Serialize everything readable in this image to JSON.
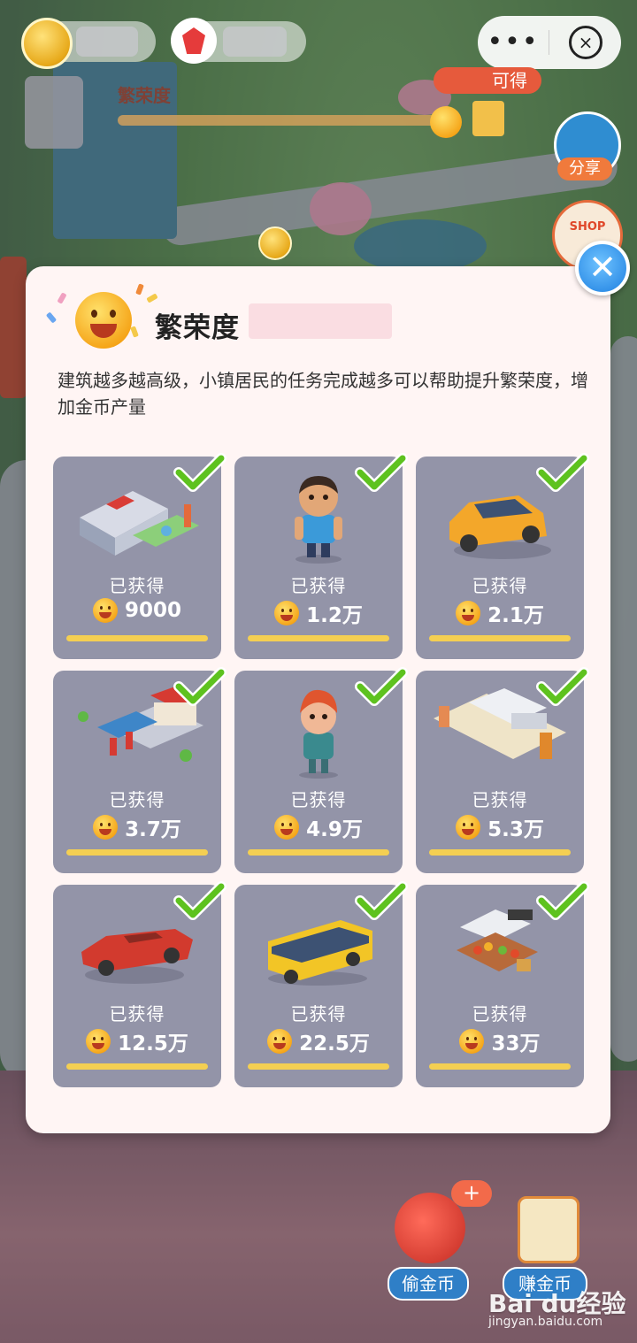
{
  "hud": {
    "prosperity_label": "繁荣度",
    "available_label": "可得",
    "share_label": "分享",
    "shop_label": "SHOP",
    "capsule_more": "•••"
  },
  "bottom": {
    "steal_label": "偷金币",
    "steal_plus": "+",
    "earn_label": "赚金币"
  },
  "watermark": {
    "brand": "Bai du经验",
    "url": "jingyan.baidu.com"
  },
  "modal": {
    "title": "繁荣度",
    "description": "建筑越多越高级，小镇居民的任务完成越多可以帮助提升繁荣度，增加金币产量",
    "close_glyph": "✕",
    "items": [
      {
        "kind": "building",
        "status": "已获得",
        "amount": "9000"
      },
      {
        "kind": "resident-boy",
        "status": "已获得",
        "amount": "1.2万"
      },
      {
        "kind": "car-yellow",
        "status": "已获得",
        "amount": "2.1万"
      },
      {
        "kind": "gas-station",
        "status": "已获得",
        "amount": "3.7万"
      },
      {
        "kind": "resident-girl",
        "status": "已获得",
        "amount": "4.9万"
      },
      {
        "kind": "bus-stop",
        "status": "已获得",
        "amount": "5.3万"
      },
      {
        "kind": "car-red",
        "status": "已获得",
        "amount": "12.5万"
      },
      {
        "kind": "bus",
        "status": "已获得",
        "amount": "22.5万"
      },
      {
        "kind": "fruit-stand",
        "status": "已获得",
        "amount": "33万"
      }
    ]
  }
}
